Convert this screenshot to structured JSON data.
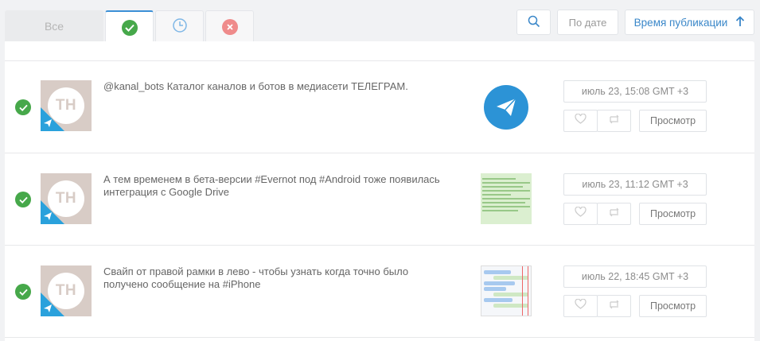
{
  "tabs": [
    {
      "label": "Все",
      "icon": "all"
    },
    {
      "label": "",
      "icon": "check-circle-icon",
      "color": "#46a84a",
      "active": true
    },
    {
      "label": "",
      "icon": "clock-icon",
      "color": "#7fb7e6"
    },
    {
      "label": "",
      "icon": "cancel-circle-icon",
      "color": "#ef8b8b"
    }
  ],
  "toolbar": {
    "search_icon": "search-icon",
    "by_date_label": "По дате",
    "publish_time_label": "Время публикации",
    "sort_icon": "arrow-up-icon"
  },
  "colors": {
    "accent": "#3a87c9",
    "status_ok": "#46a84a",
    "telegram_blue": "#2c93d6"
  },
  "posts": [
    {
      "avatar_initials": "TH",
      "text": "@kanal_bots Каталог каналов и ботов в медиасети ТЕЛЕГРАМ.",
      "thumbnail": "telegram-logo",
      "date": "июль 23, 15:08 GMT +3",
      "view_label": "Просмотр"
    },
    {
      "avatar_initials": "TH",
      "text": "А тем временем в бета-версии #Evernot под #Android тоже появилась интеграция с Google Drive",
      "thumbnail": "screenshot-text",
      "date": "июль 23, 11:12 GMT +3",
      "view_label": "Просмотр"
    },
    {
      "avatar_initials": "TH",
      "text": "Свайп от правой рамки в лево - чтобы узнать когда точно было получено сообщение на #iPhone",
      "thumbnail": "screenshot-chat",
      "date": "июль 22, 18:45 GMT +3",
      "view_label": "Просмотр"
    }
  ]
}
